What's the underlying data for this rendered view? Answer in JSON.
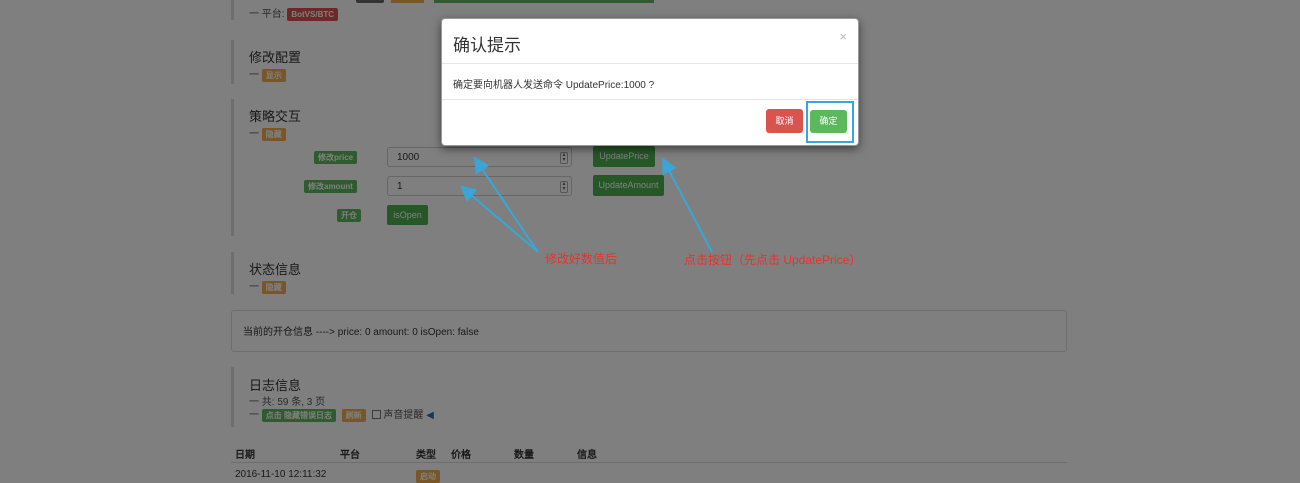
{
  "platform": {
    "prefix": "一 平台:",
    "badge": "BotVS/BTC"
  },
  "config": {
    "title": "修改配置",
    "dash": "一",
    "badge": "显示"
  },
  "strategy": {
    "title": "策略交互",
    "dash": "一",
    "badge": "隐藏",
    "rows": [
      {
        "label": "修改price",
        "value": "1000",
        "button": "UpdatePrice"
      },
      {
        "label": "修改amount",
        "value": "1",
        "button": "UpdateAmount"
      },
      {
        "label": "开仓",
        "button": "isOpen"
      }
    ]
  },
  "status": {
    "title": "状态信息",
    "dash": "一",
    "badge": "隐藏",
    "text": "当前的开仓信息 ----> price: 0 amount: 0 isOpen: false"
  },
  "logs": {
    "title": "日志信息",
    "summary": "一 共: 59 条, 3 页",
    "dash": "一",
    "hide_error_btn": "点击 隐藏错误日志",
    "refresh_btn": "刷新",
    "sound_label": "声音提醒",
    "columns": [
      "日期",
      "平台",
      "类型",
      "价格",
      "数量",
      "信息"
    ],
    "rows": [
      {
        "date": "2016-11-10 12:11:32",
        "type": "启动"
      }
    ]
  },
  "modal": {
    "title": "确认提示",
    "close": "×",
    "body": "确定要向机器人发送命令 UpdatePrice:1000 ?",
    "cancel": "取消",
    "ok": "确定"
  },
  "annotations": {
    "left": "修改好数值后",
    "right": "点击按钮（先点击 UpdatePrice）"
  },
  "colors": {
    "danger": "#d9534f",
    "success": "#5cb85c",
    "warning": "#f0ad4e",
    "annotation": "#e8322d",
    "arrow": "#3aa6d8"
  }
}
